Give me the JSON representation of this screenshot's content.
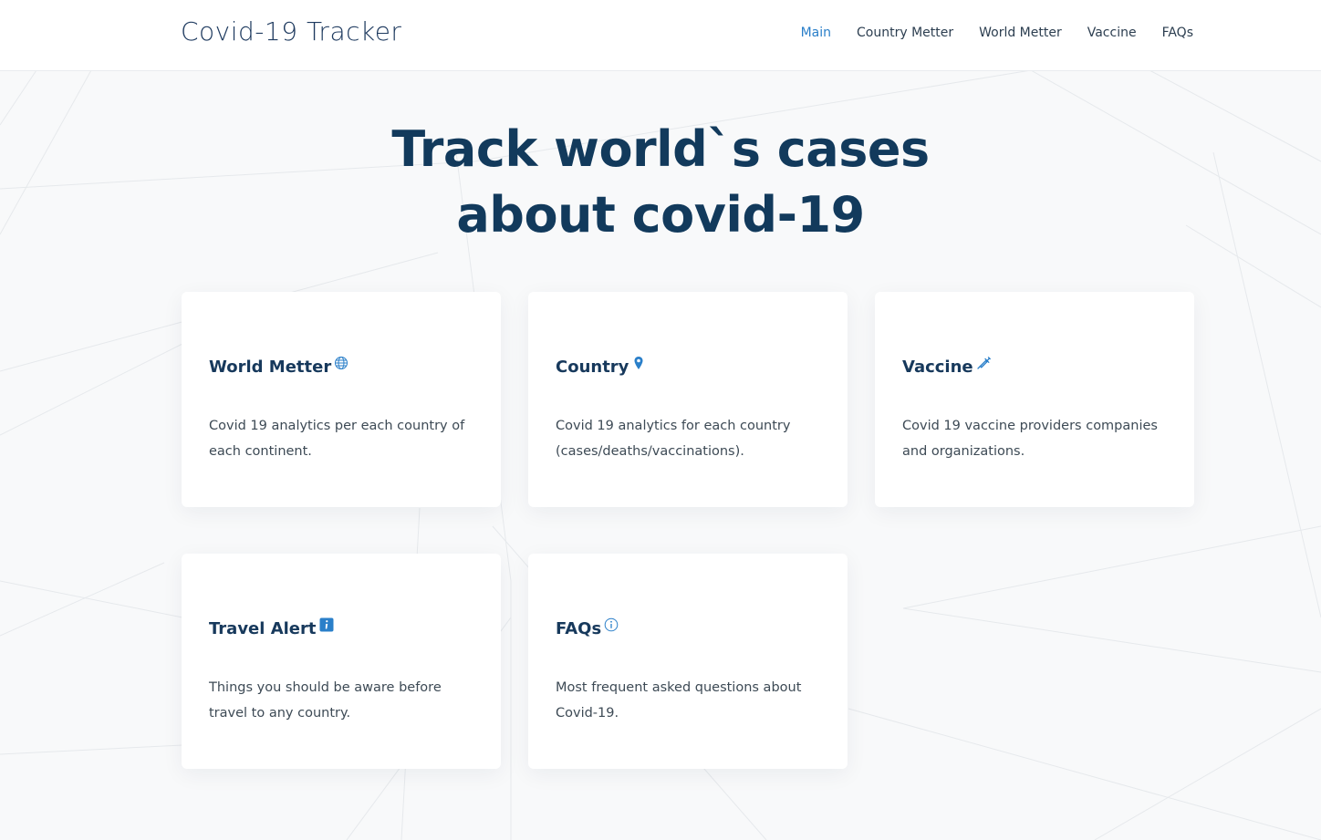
{
  "header": {
    "logo": "Covid-19 Tracker",
    "nav": [
      "Main",
      "Country Metter",
      "World Metter",
      "Vaccine",
      "FAQs"
    ]
  },
  "hero": {
    "line1": "Track world`s cases",
    "line2": "about covid-19"
  },
  "cards": [
    {
      "title": "World Metter",
      "icon": "globe-icon",
      "desc": "Covid 19 analytics per each country of each continent."
    },
    {
      "title": "Country",
      "icon": "map-pin-icon",
      "desc": "Covid 19 analytics for each country (cases/deaths/vaccinations)."
    },
    {
      "title": "Vaccine",
      "icon": "syringe-icon",
      "desc": "Covid 19 vaccine providers companies and organizations."
    },
    {
      "title": "Travel Alert",
      "icon": "info-square-icon",
      "desc": "Things you should be aware before travel to any country."
    },
    {
      "title": "FAQs",
      "icon": "info-circle-icon",
      "desc": "Most frequent asked questions about Covid-19."
    }
  ],
  "colors": {
    "primary": "#123a5c",
    "accent": "#2a7fc9",
    "background": "#f8f9fa"
  }
}
